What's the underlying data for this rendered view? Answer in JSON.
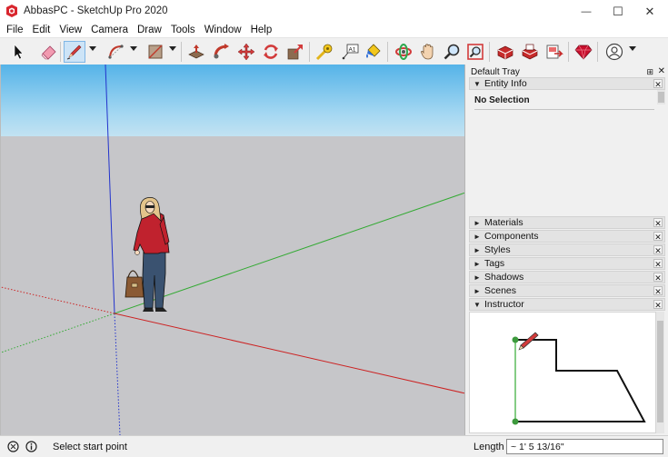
{
  "window": {
    "title": "AbbasPC - SketchUp Pro 2020",
    "controls": {
      "minimize": "—",
      "maximize": "☐",
      "close": "✕"
    }
  },
  "menu": [
    "File",
    "Edit",
    "View",
    "Camera",
    "Draw",
    "Tools",
    "Window",
    "Help"
  ],
  "toolbar": {
    "active_tool": "pencil-line-tool",
    "tools": [
      "select-arrow-icon",
      "eraser-icon",
      "pencil-line-icon",
      "arc-icon",
      "rectangle-icon",
      "push-pull-icon",
      "follow-me-icon",
      "move-icon",
      "rotate-icon",
      "scale-icon",
      "tape-measure-icon",
      "text-label-icon",
      "paint-bucket-icon",
      "orbit-icon",
      "pan-hand-icon",
      "zoom-icon",
      "zoom-extents-icon",
      "3d-warehouse-icon",
      "extension-warehouse-icon",
      "send-to-layout-icon",
      "ruby-extension-icon",
      "account-icon"
    ]
  },
  "tray": {
    "title": "Default Tray",
    "pin_glyph": "⊞",
    "close_glyph": "✕",
    "entity_info": {
      "label": "Entity Info",
      "triangle": "▼",
      "close": "✕",
      "selection": "No Selection"
    },
    "panels": [
      {
        "label": "Materials",
        "triangle": "►",
        "close": "✕"
      },
      {
        "label": "Components",
        "triangle": "►",
        "close": "✕"
      },
      {
        "label": "Styles",
        "triangle": "►",
        "close": "✕"
      },
      {
        "label": "Tags",
        "triangle": "►",
        "close": "✕"
      },
      {
        "label": "Shadows",
        "triangle": "►",
        "close": "✕"
      },
      {
        "label": "Scenes",
        "triangle": "►",
        "close": "✕"
      }
    ],
    "instructor": {
      "label": "Instructor",
      "triangle": "▼",
      "close": "✕"
    }
  },
  "status": {
    "prompt": "Select start point",
    "measure_label": "Length",
    "measure_value": "~ 1' 5 13/16\""
  },
  "colors": {
    "sky_top": "#55b3e8",
    "ground": "#c6c6c9",
    "axis_red": "#cc2222",
    "axis_green": "#33aa33",
    "axis_blue": "#2233cc",
    "selection_highlight": "#cde4f7"
  }
}
